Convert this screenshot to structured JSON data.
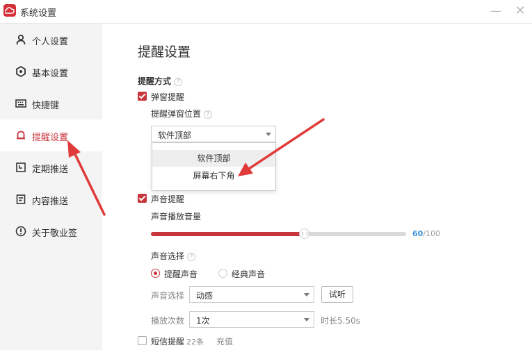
{
  "window": {
    "title": "系统设置",
    "minimize": "—",
    "close": "✕"
  },
  "sidebar": {
    "items": [
      {
        "label": "个人设置",
        "icon": "user-icon"
      },
      {
        "label": "基本设置",
        "icon": "gear-icon"
      },
      {
        "label": "快捷键",
        "icon": "keyboard-icon"
      },
      {
        "label": "提醒设置",
        "icon": "bell-icon",
        "active": true
      },
      {
        "label": "定期推送",
        "icon": "calendar-icon"
      },
      {
        "label": "内容推送",
        "icon": "document-icon"
      },
      {
        "label": "关于敬业签",
        "icon": "info-icon"
      }
    ]
  },
  "main": {
    "title": "提醒设置",
    "reminder_method": {
      "title": "提醒方式",
      "help": "?"
    },
    "popup": {
      "label": "弹窗提醒",
      "checked": true,
      "position_label": "提醒弹窗位置",
      "position_help": "?",
      "position_selected": "软件顶部",
      "options": [
        "软件顶部",
        "屏幕右下角"
      ]
    },
    "sound": {
      "label": "声音提醒",
      "checked": true,
      "volume_label": "声音播放音量",
      "volume_value": "60",
      "volume_max": "/100",
      "volume_fraction": 0.6,
      "choice_title": "声音选择",
      "choice_help": "?",
      "radio_reminder": "提醒声音",
      "radio_classic": "经典声音",
      "select_label": "声音选择",
      "select_value": "动感",
      "test_button": "试听",
      "repeat_label": "播放次数",
      "repeat_value": "1次",
      "duration": "时长5.50s"
    },
    "sms": {
      "label": "短信提醒",
      "count": "22条",
      "recharge": "充值",
      "checked": false
    }
  },
  "colors": {
    "accent": "#c8353c",
    "value_blue": "#3a8fd6",
    "annotation_arrow": "#e03b3b"
  }
}
